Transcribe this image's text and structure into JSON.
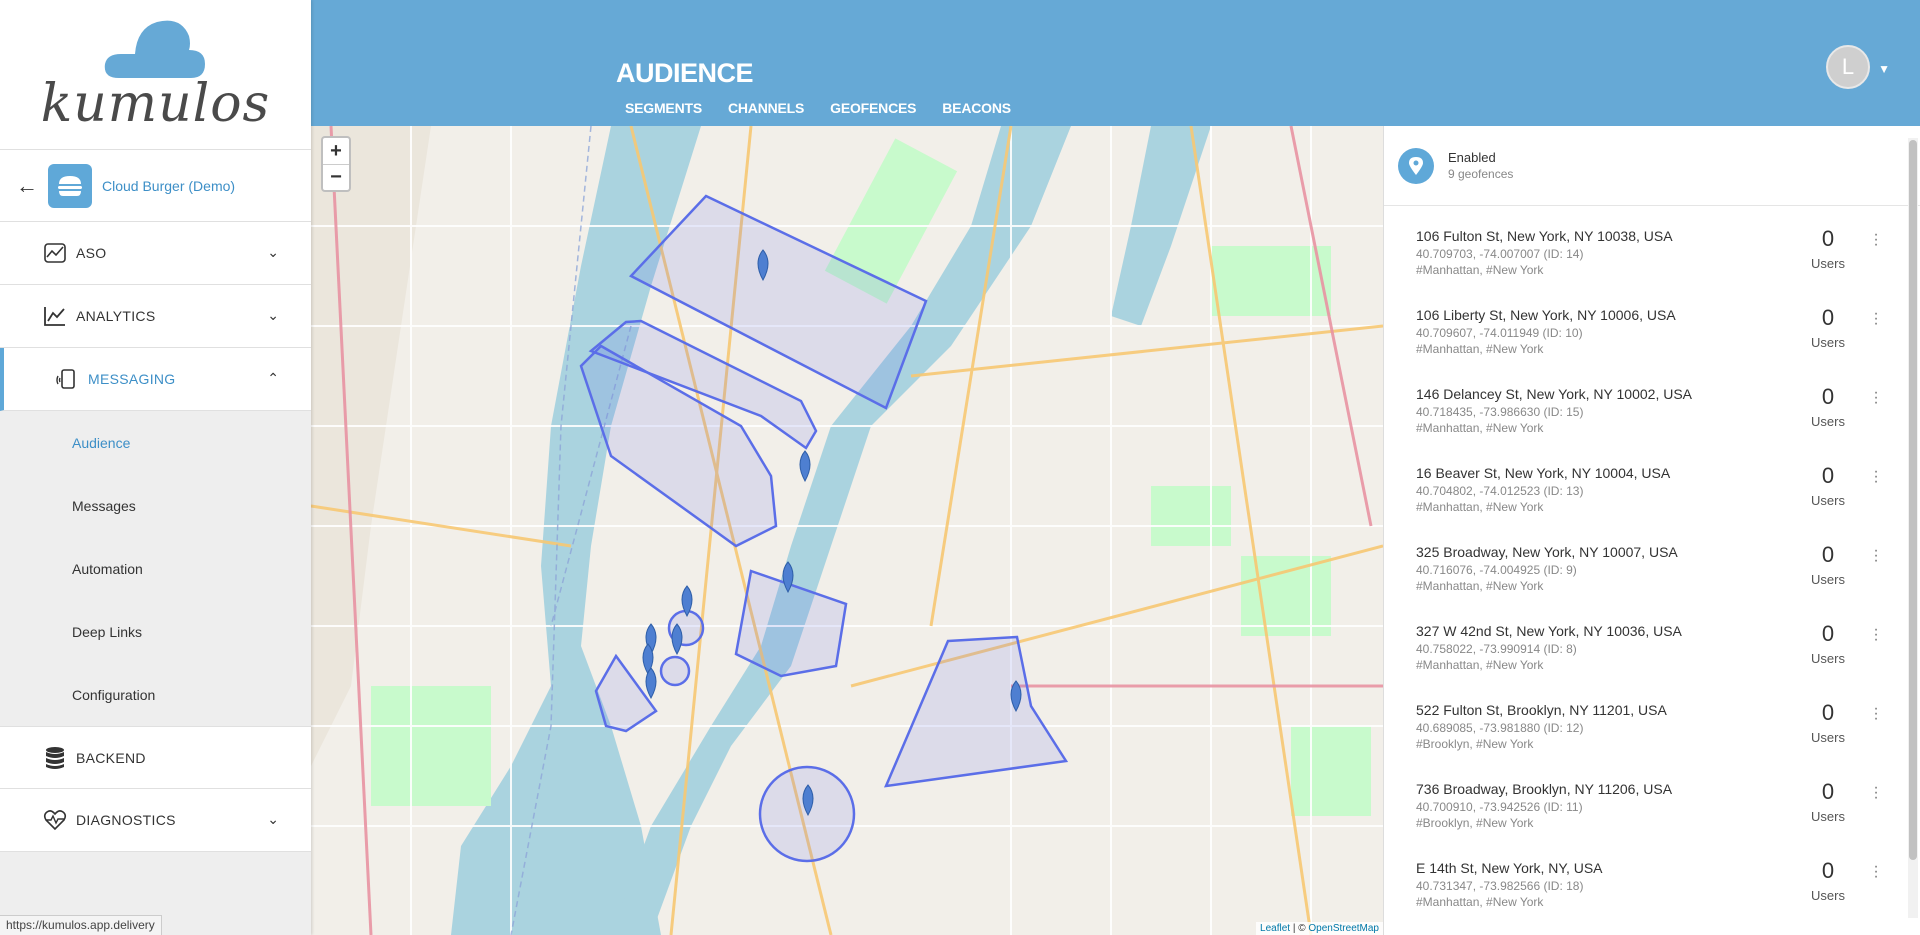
{
  "sidebar": {
    "logo_text": "kumulos",
    "app_name": "Cloud Burger (Demo)",
    "nav": [
      {
        "label": "ASO"
      },
      {
        "label": "ANALYTICS"
      },
      {
        "label": "MESSAGING"
      },
      {
        "label": "BACKEND"
      },
      {
        "label": "DIAGNOSTICS"
      }
    ],
    "messaging_sub": [
      {
        "label": "Audience"
      },
      {
        "label": "Messages"
      },
      {
        "label": "Automation"
      },
      {
        "label": "Deep Links"
      },
      {
        "label": "Configuration"
      }
    ],
    "status_url": "https://kumulos.app.delivery"
  },
  "header": {
    "title": "AUDIENCE",
    "tabs": [
      {
        "label": "SEGMENTS"
      },
      {
        "label": "CHANNELS"
      },
      {
        "label": "GEOFENCES"
      },
      {
        "label": "BEACONS"
      }
    ],
    "avatar_initial": "L"
  },
  "map": {
    "zoom_in": "+",
    "zoom_out": "−",
    "attribution_leaflet": "Leaflet",
    "attribution_sep": " | © ",
    "attribution_osm": "OpenStreetMap"
  },
  "panel": {
    "status": "Enabled",
    "count_text": "9 geofences",
    "users_label": "Users",
    "geofences": [
      {
        "address": "106 Fulton St, New York, NY 10038, USA",
        "coords": "40.709703, -74.007007 (ID: 14)",
        "tags": "#Manhattan, #New York",
        "count": "0"
      },
      {
        "address": "106 Liberty St, New York, NY 10006, USA",
        "coords": "40.709607, -74.011949 (ID: 10)",
        "tags": "#Manhattan, #New York",
        "count": "0"
      },
      {
        "address": "146 Delancey St, New York, NY 10002, USA",
        "coords": "40.718435, -73.986630 (ID: 15)",
        "tags": "#Manhattan, #New York",
        "count": "0"
      },
      {
        "address": "16 Beaver St, New York, NY 10004, USA",
        "coords": "40.704802, -74.012523 (ID: 13)",
        "tags": "#Manhattan, #New York",
        "count": "0"
      },
      {
        "address": "325 Broadway, New York, NY 10007, USA",
        "coords": "40.716076, -74.004925 (ID: 9)",
        "tags": "#Manhattan, #New York",
        "count": "0"
      },
      {
        "address": "327 W 42nd St, New York, NY 10036, USA",
        "coords": "40.758022, -73.990914 (ID: 8)",
        "tags": "#Manhattan, #New York",
        "count": "0"
      },
      {
        "address": "522 Fulton St, Brooklyn, NY 11201, USA",
        "coords": "40.689085, -73.981880 (ID: 12)",
        "tags": "#Brooklyn, #New York",
        "count": "0"
      },
      {
        "address": "736 Broadway, Brooklyn, NY 11206, USA",
        "coords": "40.700910, -73.942526 (ID: 11)",
        "tags": "#Brooklyn, #New York",
        "count": "0"
      },
      {
        "address": "E 14th St, New York, NY, USA",
        "coords": "40.731347, -73.982566 (ID: 18)",
        "tags": "#Manhattan, #New York",
        "count": "0"
      }
    ]
  },
  "colors": {
    "header": "#66a9d6",
    "accent": "#3d8fc7",
    "geofence": "#5b6ee8"
  }
}
